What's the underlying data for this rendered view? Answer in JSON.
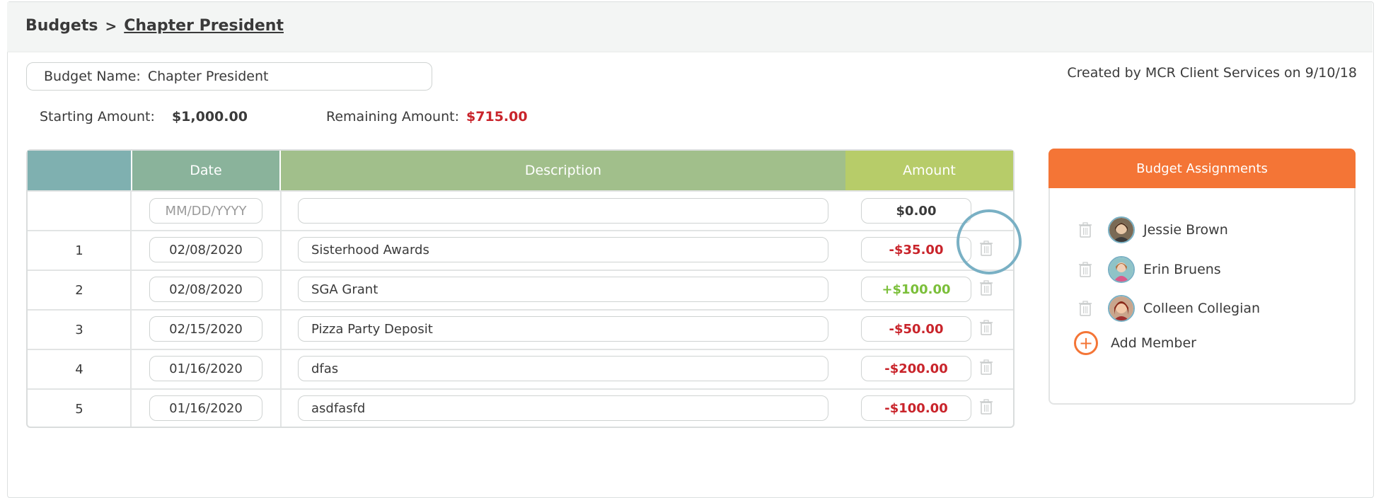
{
  "breadcrumb": {
    "root": "Budgets",
    "separator": ">",
    "current": "Chapter President"
  },
  "budget_name": {
    "label": "Budget Name:",
    "value": "Chapter President"
  },
  "created_by": "Created by MCR Client Services on 9/10/18",
  "starting": {
    "label": "Starting Amount:",
    "value": "$1,000.00"
  },
  "remaining": {
    "label": "Remaining Amount:",
    "value": "$715.00"
  },
  "table": {
    "headers": {
      "num": "",
      "date": "Date",
      "description": "Description",
      "amount": "Amount"
    },
    "new_row": {
      "date_placeholder": "MM/DD/YYYY",
      "description": "",
      "amount": "$0.00"
    },
    "rows": [
      {
        "num": "1",
        "date": "02/08/2020",
        "description": "Sisterhood Awards",
        "amount": "-$35.00"
      },
      {
        "num": "2",
        "date": "02/08/2020",
        "description": "SGA Grant",
        "amount": "+$100.00"
      },
      {
        "num": "3",
        "date": "02/15/2020",
        "description": "Pizza Party Deposit",
        "amount": "-$50.00"
      },
      {
        "num": "4",
        "date": "01/16/2020",
        "description": "dfas",
        "amount": "-$200.00"
      },
      {
        "num": "5",
        "date": "01/16/2020",
        "description": "asdfasfd",
        "amount": "-$100.00"
      }
    ]
  },
  "assignments": {
    "title": "Budget Assignments",
    "members": [
      {
        "name": "Jessie Brown"
      },
      {
        "name": "Erin Bruens"
      },
      {
        "name": "Colleen Collegian"
      }
    ],
    "add_label": "Add Member"
  },
  "colors": {
    "accent_orange": "#f47536",
    "negative_red": "#c9242b",
    "positive_green": "#7bbf3a",
    "header_teal": "#7fb0b0",
    "header_green": "#a1bf8b",
    "header_lime": "#b7cc69"
  }
}
